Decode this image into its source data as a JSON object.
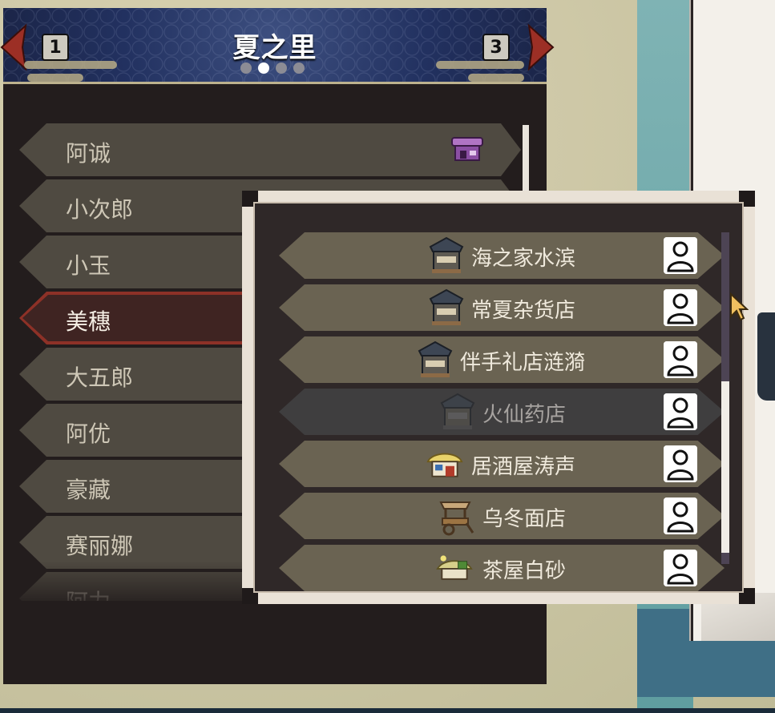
{
  "header": {
    "title": "夏之里",
    "prev_page": "1",
    "next_page": "3",
    "page_dots": 4,
    "active_dot": 2
  },
  "villagers": [
    {
      "name": "阿诚",
      "tag": "shop-purple"
    },
    {
      "name": "小次郎"
    },
    {
      "name": "小玉"
    },
    {
      "name": "美穗",
      "selected": true
    },
    {
      "name": "大五郎"
    },
    {
      "name": "阿优"
    },
    {
      "name": "豪藏"
    },
    {
      "name": "赛丽娜"
    },
    {
      "name": "阿力"
    }
  ],
  "shops": [
    {
      "name": "海之家水滨",
      "icon": "dark-shop-building-icon",
      "dimmed": false
    },
    {
      "name": "常夏杂货店",
      "icon": "dark-shop-building-icon",
      "dimmed": false
    },
    {
      "name": "伴手礼店涟漪",
      "icon": "dark-shop-building-icon",
      "dimmed": false
    },
    {
      "name": "火仙药店",
      "icon": "dark-shop-building-icon",
      "dimmed": true
    },
    {
      "name": "居酒屋涛声",
      "icon": "thatched-tavern-icon",
      "dimmed": false
    },
    {
      "name": "乌冬面店",
      "icon": "food-cart-icon",
      "dimmed": false
    },
    {
      "name": "茶屋白砂",
      "icon": "tea-house-icon",
      "dimmed": false
    }
  ],
  "colors": {
    "header_blue": "#223160",
    "selected_red": "#8d3127",
    "row_bg": "#4f4a41",
    "shop_row_bg": "#6a6352"
  }
}
